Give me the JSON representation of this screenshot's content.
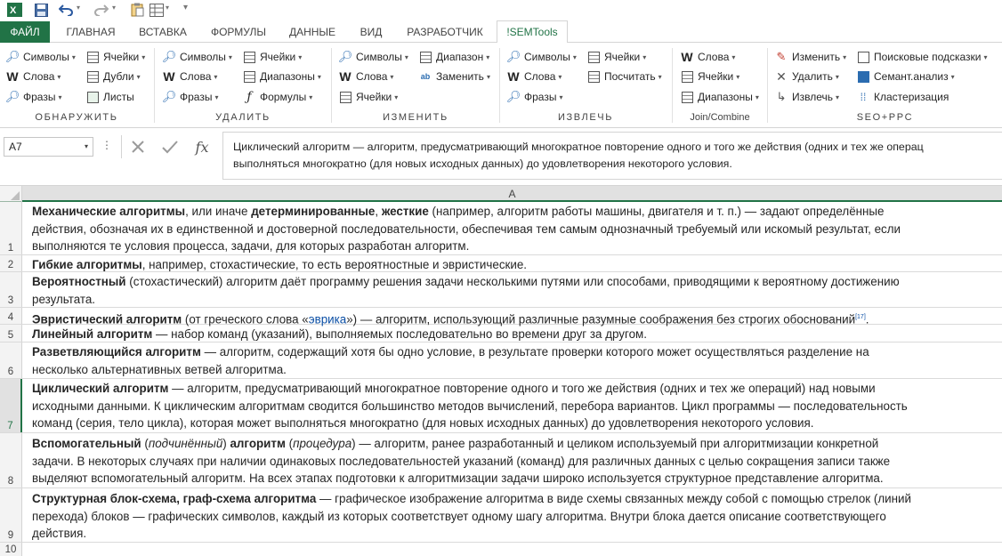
{
  "qat": {
    "icons": [
      "excel-app-icon",
      "save-icon",
      "undo-icon",
      "redo-icon",
      "paste-icon",
      "format-icon",
      "customize-icon"
    ]
  },
  "tabs": [
    {
      "label": "ФАЙЛ"
    },
    {
      "label": "ГЛАВНАЯ"
    },
    {
      "label": "ВСТАВКА"
    },
    {
      "label": "ФОРМУЛЫ"
    },
    {
      "label": "ДАННЫЕ"
    },
    {
      "label": "ВИД"
    },
    {
      "label": "РАЗРАБОТЧИК"
    },
    {
      "label": "!SEMTools"
    }
  ],
  "ribbon": {
    "find": {
      "label": "ОБНАРУЖИТЬ",
      "symbols": "Символы",
      "words": "Слова",
      "phrases": "Фразы",
      "cells": "Ячейки",
      "duplicates": "Дубли",
      "sheets": "Листы"
    },
    "remove": {
      "label": "УДАЛИТЬ",
      "symbols": "Символы",
      "words": "Слова",
      "phrases": "Фразы",
      "cells": "Ячейки",
      "ranges": "Диапазоны",
      "formulas": "Формулы"
    },
    "change": {
      "label": "ИЗМЕНИТЬ",
      "symbols": "Символы",
      "words": "Слова",
      "cells": "Ячейки",
      "range": "Диапазон",
      "replace": "Заменить"
    },
    "extract": {
      "label": "ИЗВЛЕЧЬ",
      "symbols": "Символы",
      "words": "Слова",
      "phrases": "Фразы",
      "cells": "Ячейки",
      "count": "Посчитать"
    },
    "join": {
      "label": "Join/Combine",
      "words": "Слова",
      "cells": "Ячейки",
      "ranges": "Диапазоны"
    },
    "seo": {
      "label": "SEO+PPC",
      "change": "Изменить",
      "delete": "Удалить",
      "extract": "Извлечь",
      "suggest": "Поисковые подсказки",
      "semantic": "Семант.анализ",
      "cluster": "Кластеризация"
    }
  },
  "formula_bar": {
    "name_box": "A7",
    "fx": "fx",
    "line1": "Циклический алгоритм — алгоритм, предусматривающий многократное повторение одного и того же действия (одних и тех же операц",
    "line2": "выполняться многократно (для новых исходных данных) до удовлетворения некоторого условия."
  },
  "grid": {
    "column": "A",
    "rows": {
      "r1": {
        "num": "1",
        "b1": "Механические алгоритмы",
        "t1": ", или иначе ",
        "b2": "детерминированные",
        "t2": ", ",
        "b3": "жесткие",
        "t3": " (например, алгоритм работы машины, двигателя и т. п.) — задают определённые",
        "l2": "действия, обозначая их в единственной и достоверной последовательности, обеспечивая тем самым однозначный требуемый или искомый результат, если",
        "l3": "выполняются те условия процесса, задачи, для которых разработан алгоритм."
      },
      "r2": {
        "num": "2",
        "b1": "Гибкие алгоритмы",
        "t1": ", например, стохастические, то есть вероятностные и эвристические."
      },
      "r3": {
        "num": "3",
        "b1": "Вероятностный",
        "t1": " (стохастический) алгоритм даёт программу решения задачи несколькими путями или способами, приводящими к вероятному достижению",
        "l2": "результата."
      },
      "r4": {
        "num": "4",
        "b1": "Эвристический алгоритм",
        "t1": " (от греческого слова «",
        "link": "эврика",
        "t2": "») — алгоритм, использующий различные разумные соображения без строгих обоснований",
        "sup": "[17]",
        "t3": "."
      },
      "r5": {
        "num": "5",
        "b1": "Линейный алгоритм",
        "t1": " — набор команд (указаний), выполняемых последовательно во времени друг за другом."
      },
      "r6": {
        "num": "6",
        "b1": "Разветвляющийся алгоритм",
        "t1": " — алгоритм, содержащий хотя бы одно условие, в результате проверки которого может осуществляться разделение на",
        "l2": "несколько альтернативных ветвей алгоритма."
      },
      "r7": {
        "num": "7",
        "b1": "Циклический алгоритм",
        "t1": " — алгоритм, предусматривающий многократное повторение одного и того же действия (одних и тех же операций) над новыми",
        "l2": "исходными данными. К циклическим алгоритмам сводится большинство методов вычислений, перебора вариантов. Цикл программы — последовательность",
        "l3": "команд (серия, тело цикла), которая может выполняться многократно (для новых исходных данных) до удовлетворения некоторого условия."
      },
      "r8": {
        "num": "8",
        "b1": "Вспомогательный",
        "t1": " (",
        "i1": "подчинённый",
        "t2": ") ",
        "b2": "алгоритм",
        "t3": " (",
        "i2": "процедура",
        "t4": ") — алгоритм, ранее разработанный и целиком используемый при алгоритмизации конкретной",
        "l2": "задачи. В некоторых случаях при наличии одинаковых последовательностей указаний (команд) для различных данных с целью сокращения записи также",
        "l3": "выделяют вспомогательный алгоритм. На всех этапах подготовки к алгоритмизации задачи широко используется структурное представление алгоритма."
      },
      "r9": {
        "num": "9",
        "b1": "Структурная блок-схема, граф-схема алгоритма",
        "t1": " — графическое изображение алгоритма в виде схемы связанных между собой с помощью стрелок (линий",
        "l2": "перехода) блоков — графических символов, каждый из которых соответствует одному шагу алгоритма. Внутри блока дается описание соответствующего",
        "l3": "действия."
      },
      "r10": {
        "num": "10"
      }
    }
  }
}
